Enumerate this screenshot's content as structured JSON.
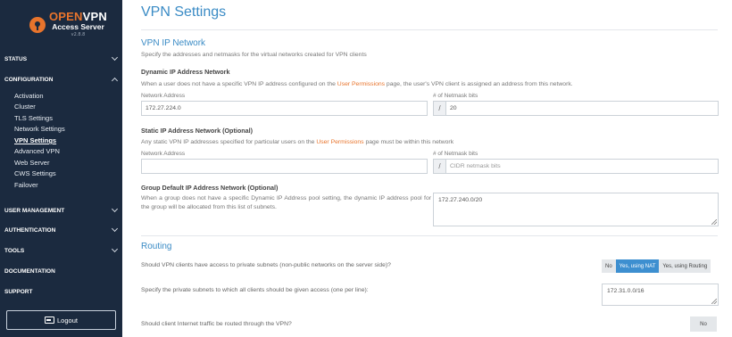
{
  "sidebar": {
    "brand_open": "OPEN",
    "brand_vpn": "VPN",
    "brand_sub": "Access Server",
    "version": "v2.8.8",
    "sections": {
      "status": "STATUS",
      "configuration": "CONFIGURATION",
      "user_management": "USER MANAGEMENT",
      "authentication": "AUTHENTICATION",
      "tools": "TOOLS",
      "documentation": "DOCUMENTATION",
      "support": "SUPPORT"
    },
    "config_items": [
      "Activation",
      "Cluster",
      "TLS Settings",
      "Network Settings",
      "VPN Settings",
      "Advanced VPN",
      "Web Server",
      "CWS Settings",
      "Failover"
    ],
    "logout": "Logout"
  },
  "main": {
    "title": "VPN Settings",
    "vpn_ip": {
      "title": "VPN IP Network",
      "desc": "Specify the addresses and netmasks for the virtual networks created for VPN clients",
      "dynamic": {
        "title": "Dynamic IP Address Network",
        "desc_before": "When a user does not have a specific VPN IP address configured on the ",
        "desc_link": "User Permissions",
        "desc_after": " page, the user's VPN client is assigned an address from this network.",
        "address_label": "Network Address",
        "address_value": "172.27.224.0",
        "netmask_label": "# of Netmask bits",
        "netmask_value": "20"
      },
      "static": {
        "title": "Static IP Address Network (Optional)",
        "desc_before": "Any static VPN IP addresses specified for particular users on the ",
        "desc_link": "User Permissions",
        "desc_after": " page must be within this network",
        "address_label": "Network Address",
        "netmask_label": "# of Netmask bits",
        "netmask_placeholder": "CIDR netmask bits"
      },
      "group": {
        "title": "Group Default IP Address Network (Optional)",
        "desc": "When a group does not have a specific Dynamic IP Address pool setting, the dynamic IP address pool for the group will be allocated from this list of subnets.",
        "value": "172.27.240.0/20"
      },
      "slash": "/"
    },
    "routing": {
      "title": "Routing",
      "q_access": "Should VPN clients have access to private subnets (non-public networks on the server side)?",
      "access_options": [
        "No",
        "Yes, using NAT",
        "Yes, using Routing"
      ],
      "access_selected": "Yes, using NAT",
      "q_subnets": "Specify the private subnets to which all clients should be given access (one per line):",
      "subnets_value": "172.31.0.0/16",
      "q_internet": "Should client Internet traffic be routed through the VPN?",
      "internet_value": "No"
    }
  }
}
